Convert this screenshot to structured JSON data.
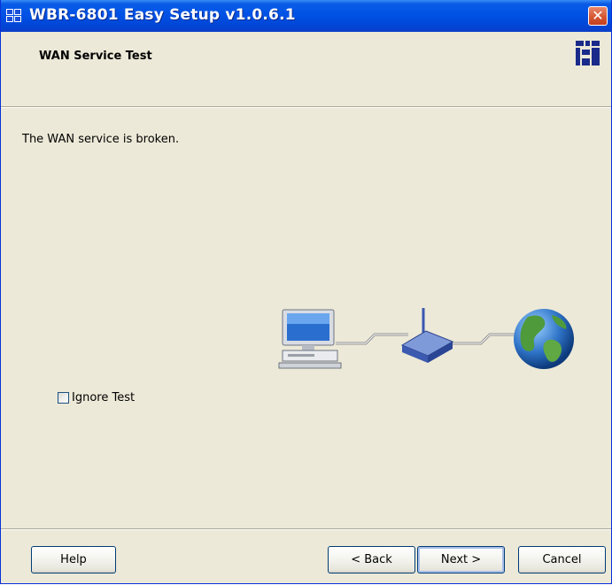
{
  "window": {
    "title": "WBR-6801 Easy Setup v1.0.6.1",
    "close_symbol": "✕"
  },
  "header": {
    "title": "WAN Service Test"
  },
  "main": {
    "status_message": "The WAN service is broken.",
    "ignore_test": {
      "label": "Ignore Test",
      "checked": false
    }
  },
  "footer": {
    "help_label": "Help",
    "back_label": "< Back",
    "next_label": "Next >",
    "cancel_label": "Cancel"
  },
  "icons": {
    "app": "app-icon",
    "logo": "levelone-logo-icon",
    "computer": "computer-icon",
    "router": "router-icon",
    "globe": "globe-icon"
  },
  "colors": {
    "titlebar": "#0052e6",
    "face": "#ece9d8",
    "button_border": "#003c74",
    "close_button": "#d45430"
  }
}
